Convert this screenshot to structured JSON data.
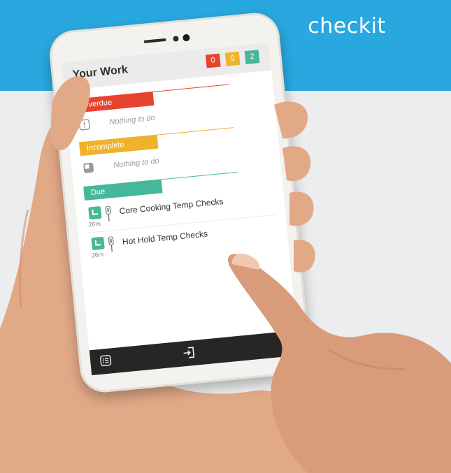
{
  "brand": {
    "name": "checkit",
    "color": "#29a8e0"
  },
  "app": {
    "title": "Your Work",
    "counts": {
      "overdue": "0",
      "incomplete": "0",
      "due": "2"
    }
  },
  "sections": {
    "overdue": {
      "label": "Overdue",
      "empty_text": "Nothing to do",
      "color": "#e8432e",
      "icon": "alert-icon"
    },
    "incomplete": {
      "label": "Incomplete",
      "empty_text": "Nothing to do",
      "color": "#efb22b",
      "icon": "partial-square-icon"
    },
    "due": {
      "label": "Due",
      "color": "#46b89a",
      "tasks": [
        {
          "title": "Core Cooking Temp Checks",
          "duration": "26m",
          "icon": "clock-icon",
          "sensor_icon": "thermometer-probe-icon"
        },
        {
          "title": "Hot Hold Temp Checks",
          "duration": "26m",
          "icon": "clock-icon",
          "sensor_icon": "thermometer-probe-icon"
        }
      ]
    }
  },
  "bottom_bar": {
    "left_icon": "checklist-menu-icon",
    "center_icon": "logout-icon"
  }
}
